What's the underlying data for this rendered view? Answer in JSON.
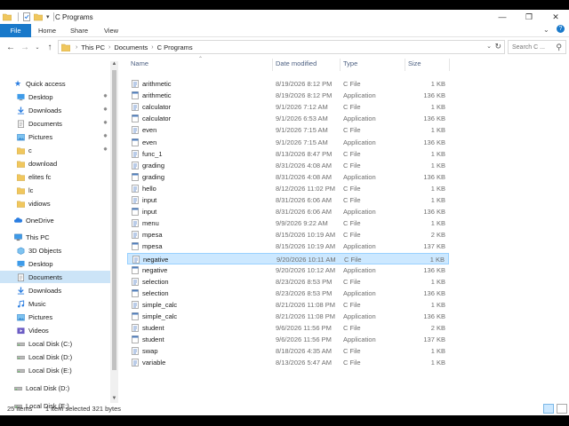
{
  "window": {
    "title": "C Programs"
  },
  "ribbon": {
    "tabs": [
      "File",
      "Home",
      "Share",
      "View"
    ]
  },
  "address": {
    "crumbs": [
      "This PC",
      "Documents",
      "C Programs"
    ],
    "search_placeholder": "Search C ..."
  },
  "sidebar": {
    "quick_access": "Quick access",
    "items": [
      {
        "label": "Desktop",
        "icon": "desktop-icon",
        "pinned": true
      },
      {
        "label": "Downloads",
        "icon": "downloads-icon",
        "pinned": true
      },
      {
        "label": "Documents",
        "icon": "documents-icon",
        "pinned": true
      },
      {
        "label": "Pictures",
        "icon": "pictures-icon",
        "pinned": true
      },
      {
        "label": "c",
        "icon": "folder-icon",
        "pinned": true
      },
      {
        "label": "download",
        "icon": "folder-icon",
        "pinned": false
      },
      {
        "label": "elites fc",
        "icon": "folder-icon",
        "pinned": false
      },
      {
        "label": "lc",
        "icon": "folder-icon",
        "pinned": false
      },
      {
        "label": "vidiows",
        "icon": "folder-icon",
        "pinned": false
      }
    ],
    "onedrive": "OneDrive",
    "this_pc": "This PC",
    "pc_items": [
      {
        "label": "3D Objects",
        "icon": "cube-icon"
      },
      {
        "label": "Desktop",
        "icon": "desktop-icon"
      },
      {
        "label": "Documents",
        "icon": "documents-icon",
        "selected": true
      },
      {
        "label": "Downloads",
        "icon": "downloads-icon"
      },
      {
        "label": "Music",
        "icon": "music-icon"
      },
      {
        "label": "Pictures",
        "icon": "pictures-icon"
      },
      {
        "label": "Videos",
        "icon": "videos-icon"
      },
      {
        "label": "Local Disk (C:)",
        "icon": "drive-icon"
      },
      {
        "label": "Local Disk (D:)",
        "icon": "drive-icon"
      },
      {
        "label": "Local Disk (E:)",
        "icon": "drive-icon"
      }
    ],
    "extra_drives": [
      {
        "label": "Local Disk (D:)",
        "icon": "drive-icon"
      },
      {
        "label": "Local Disk (E:)",
        "icon": "drive-icon"
      }
    ]
  },
  "columns": {
    "name": "Name",
    "date": "Date modified",
    "type": "Type",
    "size": "Size"
  },
  "files": [
    {
      "name": "arithmetic",
      "date": "8/19/2026 8:12 PM",
      "type": "C File",
      "size": "1 KB"
    },
    {
      "name": "arithmetic",
      "date": "8/19/2026 8:12 PM",
      "type": "Application",
      "size": "136 KB"
    },
    {
      "name": "calculator",
      "date": "9/1/2026 7:12 AM",
      "type": "C File",
      "size": "1 KB"
    },
    {
      "name": "calculator",
      "date": "9/1/2026 6:53 AM",
      "type": "Application",
      "size": "136 KB"
    },
    {
      "name": "even",
      "date": "9/1/2026 7:15 AM",
      "type": "C File",
      "size": "1 KB"
    },
    {
      "name": "even",
      "date": "9/1/2026 7:15 AM",
      "type": "Application",
      "size": "136 KB"
    },
    {
      "name": "func_1",
      "date": "8/13/2026 8:47 PM",
      "type": "C File",
      "size": "1 KB"
    },
    {
      "name": "grading",
      "date": "8/31/2026 4:08 AM",
      "type": "C File",
      "size": "1 KB"
    },
    {
      "name": "grading",
      "date": "8/31/2026 4:08 AM",
      "type": "Application",
      "size": "136 KB"
    },
    {
      "name": "hello",
      "date": "8/12/2026 11:02 PM",
      "type": "C File",
      "size": "1 KB"
    },
    {
      "name": "input",
      "date": "8/31/2026 6:06 AM",
      "type": "C File",
      "size": "1 KB"
    },
    {
      "name": "input",
      "date": "8/31/2026 6:06 AM",
      "type": "Application",
      "size": "136 KB"
    },
    {
      "name": "menu",
      "date": "9/9/2026 9:22 AM",
      "type": "C File",
      "size": "1 KB"
    },
    {
      "name": "mpesa",
      "date": "8/15/2026 10:19 AM",
      "type": "C File",
      "size": "2 KB"
    },
    {
      "name": "mpesa",
      "date": "8/15/2026 10:19 AM",
      "type": "Application",
      "size": "137 KB"
    },
    {
      "name": "negative",
      "date": "9/20/2026 10:11 AM",
      "type": "C File",
      "size": "1 KB",
      "selected": true
    },
    {
      "name": "negative",
      "date": "9/20/2026 10:12 AM",
      "type": "Application",
      "size": "136 KB"
    },
    {
      "name": "selection",
      "date": "8/23/2026 8:53 PM",
      "type": "C File",
      "size": "1 KB"
    },
    {
      "name": "selection",
      "date": "8/23/2026 8:53 PM",
      "type": "Application",
      "size": "136 KB"
    },
    {
      "name": "simple_calc",
      "date": "8/21/2026 11:08 PM",
      "type": "C File",
      "size": "1 KB"
    },
    {
      "name": "simple_calc",
      "date": "8/21/2026 11:08 PM",
      "type": "Application",
      "size": "136 KB"
    },
    {
      "name": "student",
      "date": "9/6/2026 11:56 PM",
      "type": "C File",
      "size": "2 KB"
    },
    {
      "name": "student",
      "date": "9/6/2026 11:56 PM",
      "type": "Application",
      "size": "137 KB"
    },
    {
      "name": "swap",
      "date": "8/18/2026 4:35 AM",
      "type": "C File",
      "size": "1 KB"
    },
    {
      "name": "variable",
      "date": "8/13/2026 5:47 AM",
      "type": "C File",
      "size": "1 KB"
    }
  ],
  "status": {
    "count": "25 items",
    "selection": "1 item selected  321 bytes"
  },
  "colors": {
    "accent": "#1979ca",
    "selection": "#cce8ff",
    "folder": "#f0c75e"
  }
}
